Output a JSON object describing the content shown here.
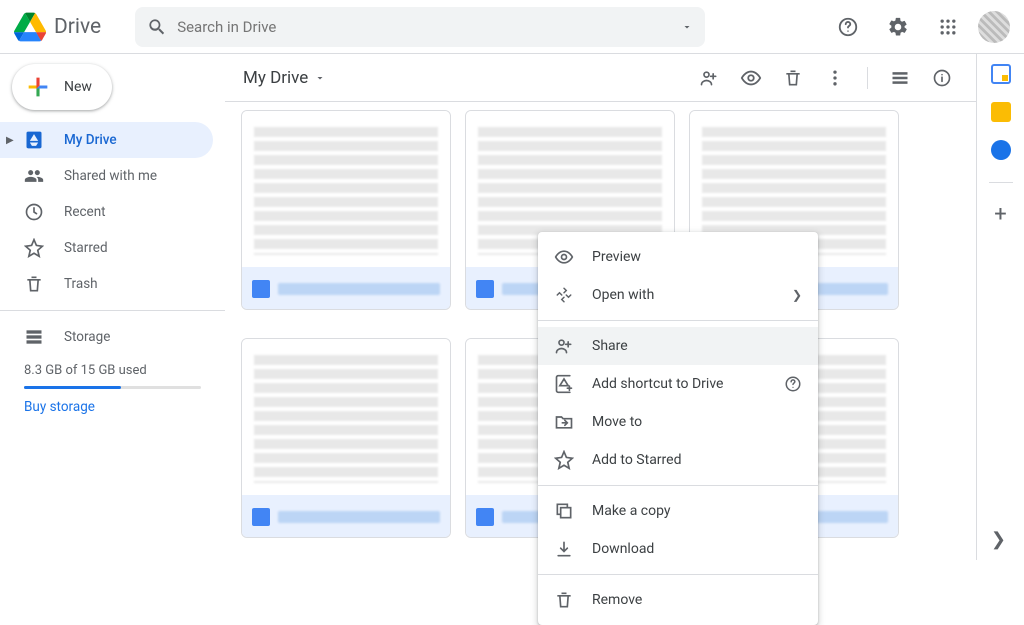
{
  "app": {
    "name": "Drive"
  },
  "search": {
    "placeholder": "Search in Drive"
  },
  "sidebar": {
    "new_label": "New",
    "items": [
      {
        "label": "My Drive"
      },
      {
        "label": "Shared with me"
      },
      {
        "label": "Recent"
      },
      {
        "label": "Starred"
      },
      {
        "label": "Trash"
      }
    ],
    "storage_label": "Storage",
    "storage_used": "8.3 GB of 15 GB used",
    "buy_label": "Buy storage"
  },
  "toolbar": {
    "location": "My Drive"
  },
  "context_menu": {
    "items": [
      {
        "label": "Preview"
      },
      {
        "label": "Open with"
      },
      {
        "label": "Share"
      },
      {
        "label": "Add shortcut to Drive"
      },
      {
        "label": "Move to"
      },
      {
        "label": "Add to Starred"
      },
      {
        "label": "Make a copy"
      },
      {
        "label": "Download"
      },
      {
        "label": "Remove"
      }
    ]
  }
}
